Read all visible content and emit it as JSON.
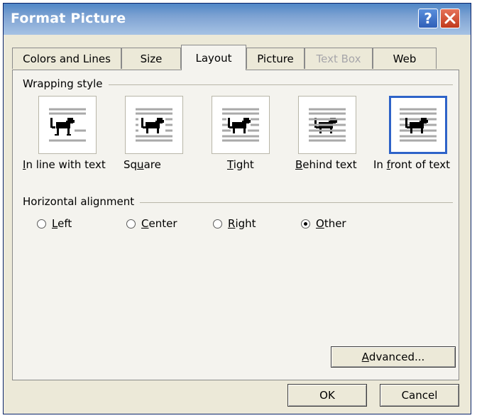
{
  "window": {
    "title": "Format Picture",
    "help_glyph": "?",
    "close_glyph": "✕"
  },
  "tabs": [
    {
      "label": "Colors and Lines",
      "state": "normal"
    },
    {
      "label": "Size",
      "state": "normal"
    },
    {
      "label": "Layout",
      "state": "active"
    },
    {
      "label": "Picture",
      "state": "normal"
    },
    {
      "label": "Text Box",
      "state": "disabled"
    },
    {
      "label": "Web",
      "state": "normal"
    }
  ],
  "wrapping": {
    "group_label": "Wrapping style",
    "options": [
      {
        "label_pre": "",
        "label_key": "I",
        "label_post": "n line with text",
        "icon": "inline-dog-icon"
      },
      {
        "label_pre": "Sq",
        "label_key": "u",
        "label_post": "are",
        "icon": "square-dog-icon"
      },
      {
        "label_pre": "",
        "label_key": "T",
        "label_post": "ight",
        "icon": "tight-dog-icon"
      },
      {
        "label_pre": "",
        "label_key": "B",
        "label_post": "ehind text",
        "icon": "behind-dog-icon"
      },
      {
        "label_pre": "In ",
        "label_key": "f",
        "label_post": "ront of text",
        "icon": "front-dog-icon"
      }
    ],
    "selected": "In front of text"
  },
  "alignment": {
    "group_label": "Horizontal alignment",
    "options": [
      {
        "label_key": "L",
        "label_post": "eft"
      },
      {
        "label_key": "C",
        "label_post": "enter"
      },
      {
        "label_key": "R",
        "label_post": "ight"
      },
      {
        "label_key": "O",
        "label_post": "ther"
      }
    ],
    "selected": "Other"
  },
  "buttons": {
    "advanced_key": "A",
    "advanced_post": "dvanced...",
    "ok": "OK",
    "cancel": "Cancel"
  },
  "colors": {
    "accent": "#2e63c8",
    "title_bar": "#4f86c6",
    "dialog_bg": "#ece9d8",
    "panel_bg": "#f4f3ee",
    "disabled_text": "#a7a6aa"
  }
}
